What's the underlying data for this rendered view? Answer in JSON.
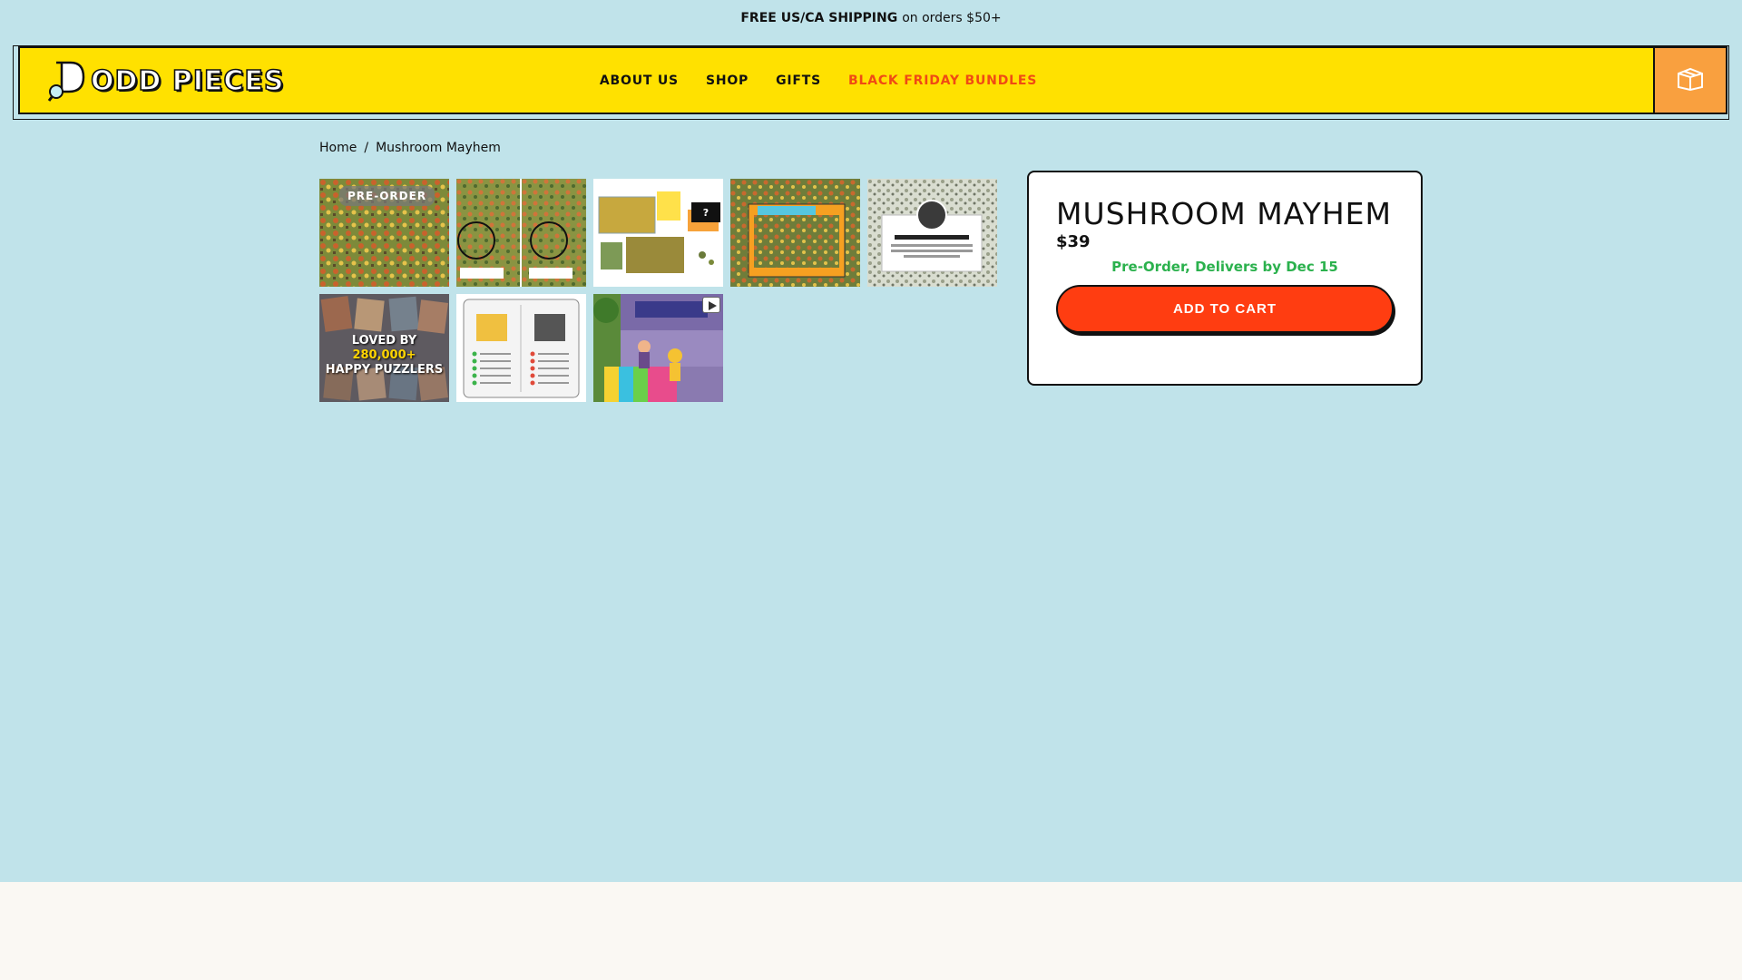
{
  "announcement": {
    "bold": "FREE US/CA SHIPPING",
    "rest": "on orders $50+"
  },
  "brand": {
    "name": "ODD PIECES"
  },
  "nav": {
    "items": [
      {
        "label": "ABOUT US"
      },
      {
        "label": "SHOP"
      },
      {
        "label": "GIFTS"
      },
      {
        "label": "BLACK FRIDAY BUNDLES"
      }
    ]
  },
  "breadcrumb": {
    "home": "Home",
    "separator": "/",
    "current": "Mushroom Mayhem"
  },
  "gallery": {
    "badge": "PRE-ORDER",
    "loved_line1_prefix": "LOVED BY ",
    "loved_highlight": "280,000+",
    "loved_line2": "HAPPY PUZZLERS",
    "question_mark": "?"
  },
  "product": {
    "title": "MUSHROOM MAYHEM",
    "price": "$39",
    "preorder_note": "Pre-Order, Delivers by Dec 15",
    "add_to_cart": "ADD TO CART"
  },
  "colors": {
    "page_bg": "#c0e3ea",
    "header_bg": "#ffe100",
    "accent_nav": "#f04a14",
    "cart_box": "#f9a03f",
    "cta": "#ff3d11",
    "preorder_green": "#2bb14d"
  },
  "icons": {
    "cart": "box-icon",
    "video": "play-icon"
  }
}
